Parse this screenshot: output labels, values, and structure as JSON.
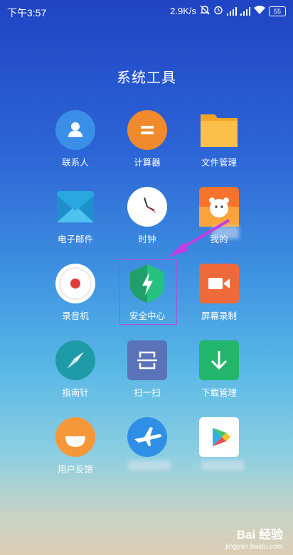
{
  "status_bar": {
    "time": "下午3:57",
    "speed": "2.9K/s",
    "battery": "55"
  },
  "folder": {
    "title": "系统工具"
  },
  "apps": [
    {
      "label": "联系人",
      "icon": "contacts-icon"
    },
    {
      "label": "计算器",
      "icon": "calculator-icon"
    },
    {
      "label": "文件管理",
      "icon": "folder-icon"
    },
    {
      "label": "电子邮件",
      "icon": "mail-icon"
    },
    {
      "label": "时钟",
      "icon": "clock-icon"
    },
    {
      "label": "我的",
      "icon": "mi-bear-icon"
    },
    {
      "label": "录音机",
      "icon": "recorder-icon"
    },
    {
      "label": "安全中心",
      "icon": "security-shield-icon"
    },
    {
      "label": "屏幕录制",
      "icon": "screen-record-icon"
    },
    {
      "label": "指南针",
      "icon": "compass-icon"
    },
    {
      "label": "扫一扫",
      "icon": "scanner-icon"
    },
    {
      "label": "下载管理",
      "icon": "download-icon"
    },
    {
      "label": "用户反馈",
      "icon": "feedback-icon"
    },
    {
      "label": "",
      "icon": "airplane-icon"
    },
    {
      "label": "",
      "icon": "play-store-icon"
    }
  ],
  "watermark": {
    "brand": "Bai 经验",
    "url": "jingyan.baidu.com"
  },
  "colors": {
    "highlight": "#b14de0",
    "arrow": "#c13de6"
  }
}
